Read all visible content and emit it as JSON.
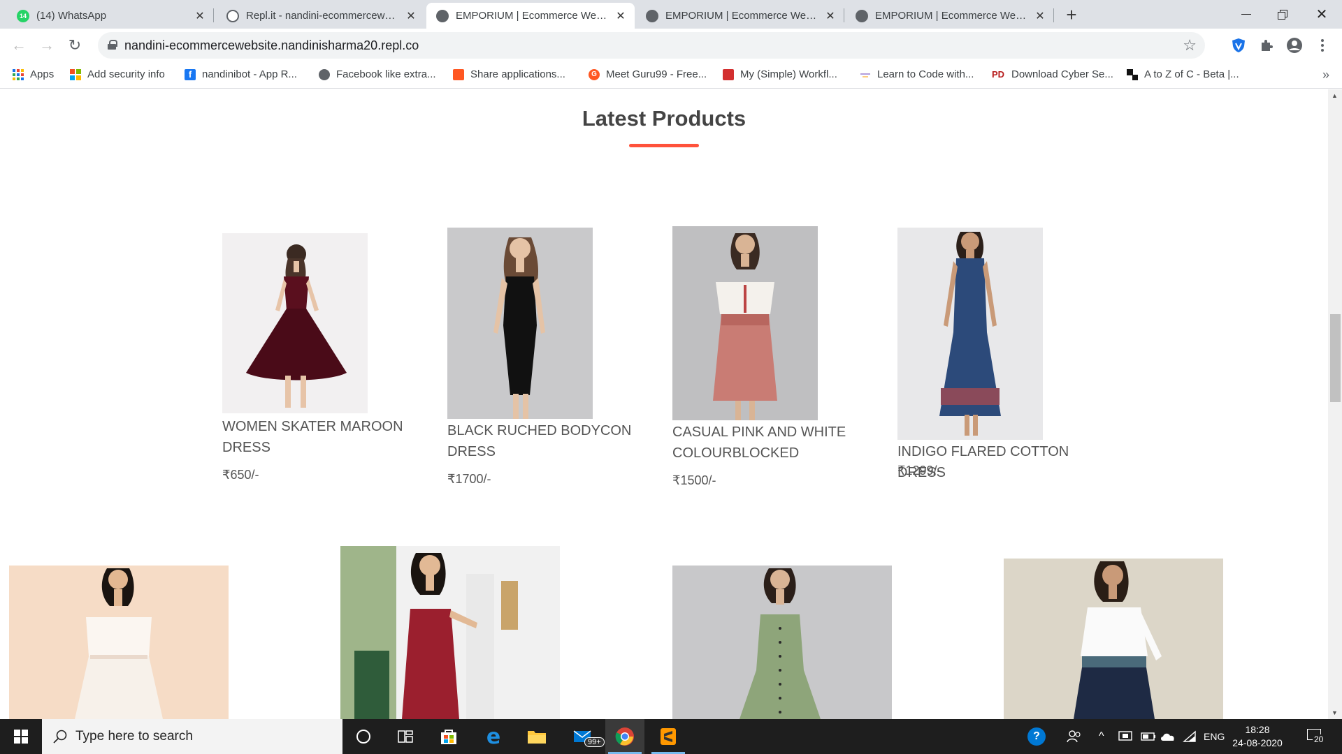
{
  "browser": {
    "tabs": [
      {
        "title": "(14) WhatsApp",
        "icon": "whatsapp-icon"
      },
      {
        "title": "Repl.it - nandini-ecommercewebsite",
        "icon": "replit-icon"
      },
      {
        "title": "EMPORIUM | Ecommerce Website",
        "icon": "globe-icon"
      },
      {
        "title": "EMPORIUM | Ecommerce Website",
        "icon": "globe-icon"
      },
      {
        "title": "EMPORIUM | Ecommerce Website",
        "icon": "globe-icon"
      }
    ],
    "whatsapp_badge": "14",
    "url": "nandini-ecommercewebsite.nandinisharma20.repl.co",
    "bookmarks": [
      {
        "label": "Apps"
      },
      {
        "label": "Add security info"
      },
      {
        "label": "nandinibot - App R..."
      },
      {
        "label": "Facebook like extra..."
      },
      {
        "label": "Share applications..."
      },
      {
        "label": "Meet Guru99 - Free..."
      },
      {
        "label": "My (Simple) Workfl..."
      },
      {
        "label": "Learn to Code with..."
      },
      {
        "label": "Download Cyber Se..."
      },
      {
        "label": "A to Z of C - Beta |..."
      }
    ],
    "bookmark_icon_text": {
      "pd": "PD",
      "meet": "G"
    }
  },
  "page": {
    "section_title": "Latest Products",
    "accent_color": "#ff523b",
    "products": [
      {
        "name": "WOMEN SKATER MAROON DRESS",
        "price": "₹650/-"
      },
      {
        "name": "BLACK RUCHED BODYCON DRESS",
        "price": "₹1700/-"
      },
      {
        "name": "CASUAL PINK AND WHITE COLOURBLOCKED",
        "price": "₹1500/-"
      },
      {
        "name": "INDIGO FLARED COTTON DRESS",
        "price": "₹1299/-"
      }
    ]
  },
  "taskbar": {
    "search_placeholder": "Type here to search",
    "mail_badge": "99+",
    "language": "ENG",
    "time": "18:28",
    "date": "24-08-2020",
    "notification_count": "20"
  }
}
